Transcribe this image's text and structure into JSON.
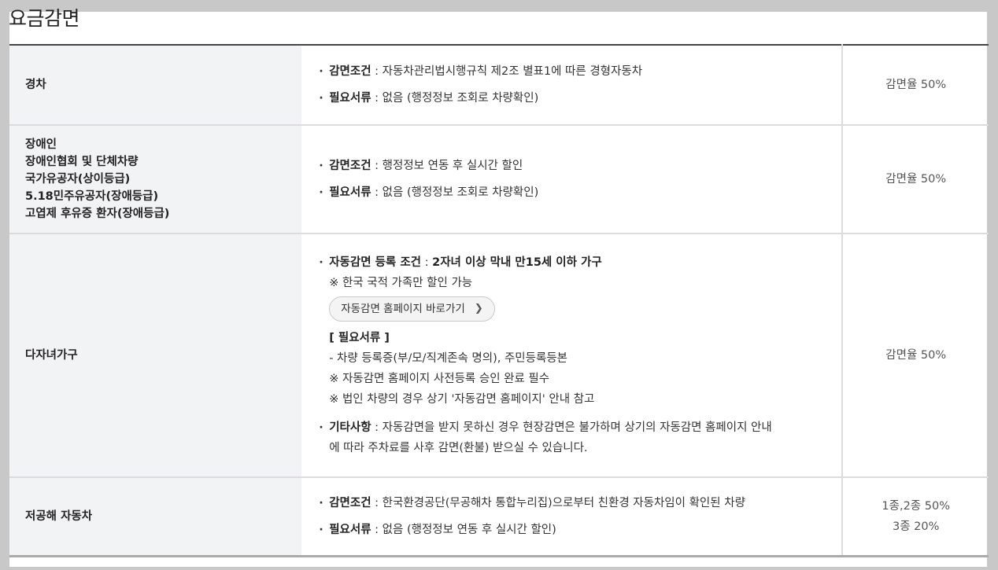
{
  "page": {
    "title": "요금감면"
  },
  "rows": [
    {
      "label_lines": [
        "경차"
      ],
      "rate": [
        "감면율 50%"
      ],
      "condition_term": "감면조건",
      "condition_text": " : 자동차관리법시행규칙 제2조 별표1에 따른 경형자동차",
      "docs_term": "필요서류",
      "docs_text": " : 없음 (행정정보 조회로 차량확인)"
    },
    {
      "label_lines": [
        "장애인",
        "장애인협회 및 단체차량",
        "국가유공자(상이등급)",
        "5.18민주유공자(장애등급)",
        "고엽제 후유증 환자(장애등급)"
      ],
      "rate": [
        "감면율 50%"
      ],
      "condition_term": "감면조건",
      "condition_text": " : 행정정보 연동 후 실시간 할인",
      "docs_term": "필요서류",
      "docs_text": " : 없음 (행정정보 조회로 차량확인)"
    },
    {
      "label_lines": [
        "다자녀가구"
      ],
      "rate": [
        "감면율 50%"
      ],
      "registration_term": "자동감면 등록 조건",
      "registration_sep": " : ",
      "registration_text": "2자녀 이상 막내 만15세 이하 가구",
      "nationality_note": "※ 한국 국적 가족만 할인 가능",
      "homepage_button": "자동감면 홈페이지 바로가기",
      "docs_heading": "[ 필요서류 ]",
      "docs_items": [
        "- 차량 등록증(부/모/직계존속 명의), 주민등록등본",
        "※ 자동감면 홈페이지 사전등록 승인 완료 필수",
        "※ 법인 차량의 경우 상기 '자동감면 홈페이지' 안내 참고"
      ],
      "etc_term": "기타사항",
      "etc_text_1": " : 자동감면을 받지 못하신 경우 현장감면은 불가하며 상기의 자동감면 홈페이지 안내",
      "etc_text_2": "에 따라 주차료를 사후 감면(환불) 받으실 수 있습니다."
    },
    {
      "label_lines": [
        "저공해 자동차"
      ],
      "rate": [
        "1종,2종 50%",
        "3종 20%"
      ],
      "condition_term": "감면조건",
      "condition_text": " : 한국환경공단(무공해차 통합누리집)으로부터 친환경 자동차임이 확인된 차량",
      "docs_term": "필요서류",
      "docs_text": " : 없음 (행정정보 연동 후 실시간 할인)"
    }
  ],
  "icons": {
    "bullet": "middle-dot",
    "chevron": "chevron-right-icon"
  },
  "colors": {
    "background": "#c8c8c8",
    "label_cell_bg": "#f2f3f5",
    "panel_bg": "#ffffff"
  }
}
